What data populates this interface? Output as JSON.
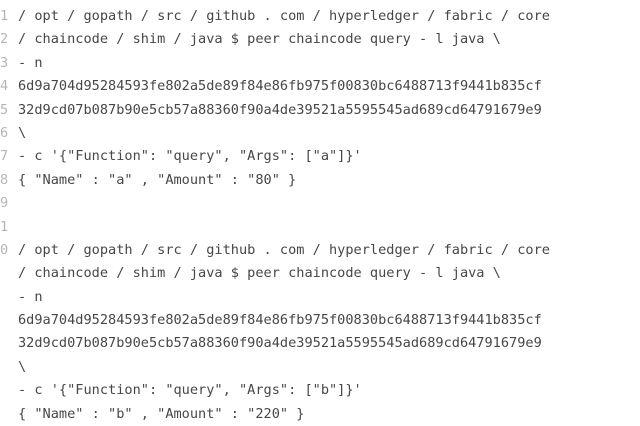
{
  "code": {
    "lines": [
      {
        "num": "1",
        "text": "/ opt / gopath / src / github . com / hyperledger / fabric / core"
      },
      {
        "num": "2",
        "text": "/ chaincode / shim / java $ peer chaincode query - l java \\"
      },
      {
        "num": "3",
        "text": "- n"
      },
      {
        "num": "4",
        "text": "6d9a704d95284593fe802a5de89f84e86fb975f00830bc6488713f9441b835cf"
      },
      {
        "num": "5",
        "text": "32d9cd07b087b90e5cb57a88360f90a4de39521a5595545ad689cd64791679e9"
      },
      {
        "num": "6",
        "text": "\\"
      },
      {
        "num": "7",
        "text": "- c '{\"Function\": \"query\", \"Args\": [\"a\"]}'"
      },
      {
        "num": "8",
        "text": "{ \"Name\" : \"a\" , \"Amount\" : \"80\" }"
      },
      {
        "num": "9",
        "text": ""
      },
      {
        "num": "1",
        "text": ""
      },
      {
        "num": "0",
        "text": "/ opt / gopath / src / github . com / hyperledger / fabric / core"
      },
      {
        "num": "",
        "text": "/ chaincode / shim / java $ peer chaincode query - l java \\"
      },
      {
        "num": "",
        "text": "- n"
      },
      {
        "num": "",
        "text": "6d9a704d95284593fe802a5de89f84e86fb975f00830bc6488713f9441b835cf"
      },
      {
        "num": "",
        "text": "32d9cd07b087b90e5cb57a88360f90a4de39521a5595545ad689cd64791679e9"
      },
      {
        "num": "",
        "text": "\\"
      },
      {
        "num": "",
        "text": "- c '{\"Function\": \"query\", \"Args\": [\"b\"]}'"
      },
      {
        "num": "",
        "text": "{ \"Name\" : \"b\" , \"Amount\" : \"220\" }"
      }
    ]
  }
}
